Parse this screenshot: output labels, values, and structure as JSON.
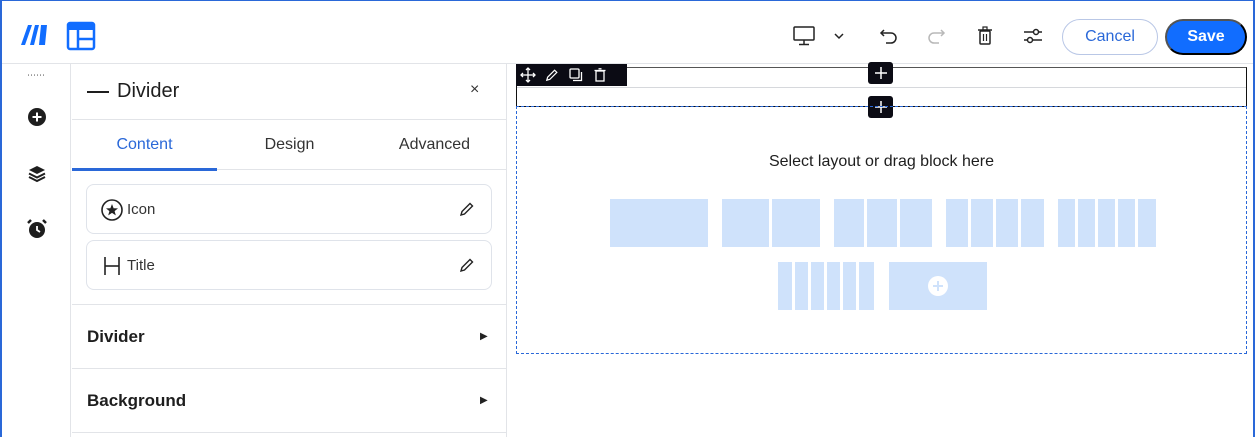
{
  "topbar": {
    "logo_icon": "wix-bars-logo-icon",
    "layout_icon": "layout-panel-icon",
    "device_icon": "desktop-monitor-icon",
    "device_dropdown_icon": "chevron-down-icon",
    "undo_icon": "undo-icon",
    "redo_icon": "redo-icon",
    "delete_icon": "trash-icon",
    "settings_icon": "sliders-icon",
    "cancel_label": "Cancel",
    "save_label": "Save",
    "accent_color": "#116dff"
  },
  "rail": {
    "items": [
      {
        "icon": "plus-circle-icon"
      },
      {
        "icon": "layers-icon"
      },
      {
        "icon": "alarm-clock-icon"
      }
    ]
  },
  "panel": {
    "title": "Divider",
    "close_label": "×",
    "tabs": [
      {
        "label": "Content",
        "active": true
      },
      {
        "label": "Design",
        "active": false
      },
      {
        "label": "Advanced",
        "active": false
      }
    ],
    "items": [
      {
        "label": "Icon",
        "icon": "star-circle-icon"
      },
      {
        "label": "Title",
        "icon": "heading-h-icon"
      }
    ],
    "sections": [
      {
        "label": "Divider"
      },
      {
        "label": "Background"
      }
    ]
  },
  "canvas": {
    "dropzone_title": "Select layout or drag block here",
    "toolbar_icons": [
      "move-icon",
      "pencil-icon",
      "duplicate-icon",
      "trash-icon"
    ],
    "layout_options": [
      1,
      2,
      3,
      4,
      5,
      6
    ],
    "add_layout_icon": "plus-circle-icon"
  }
}
